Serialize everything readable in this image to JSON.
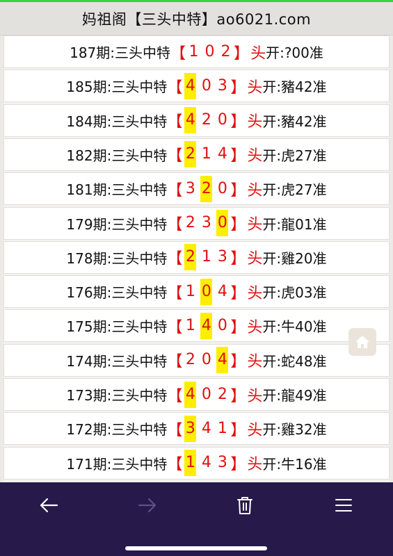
{
  "header": {
    "title": "妈祖阁【三头中特】ao6021.com"
  },
  "rows": [
    {
      "period": "187期:三头中特",
      "digits": [
        "1",
        "0",
        "2"
      ],
      "hit": -1,
      "result": "开:?00准"
    },
    {
      "period": "185期:三头中特",
      "digits": [
        "4",
        "0",
        "3"
      ],
      "hit": 0,
      "result": "开:豬42准"
    },
    {
      "period": "184期:三头中特",
      "digits": [
        "4",
        "2",
        "0"
      ],
      "hit": 0,
      "result": "开:豬42准"
    },
    {
      "period": "182期:三头中特",
      "digits": [
        "2",
        "1",
        "4"
      ],
      "hit": 0,
      "result": "开:虎27准"
    },
    {
      "period": "181期:三头中特",
      "digits": [
        "3",
        "2",
        "0"
      ],
      "hit": 1,
      "result": "开:虎27准"
    },
    {
      "period": "179期:三头中特",
      "digits": [
        "2",
        "3",
        "0"
      ],
      "hit": 2,
      "result": "开:龍01准"
    },
    {
      "period": "178期:三头中特",
      "digits": [
        "2",
        "1",
        "3"
      ],
      "hit": 0,
      "result": "开:雞20准"
    },
    {
      "period": "176期:三头中特",
      "digits": [
        "1",
        "0",
        "4"
      ],
      "hit": 1,
      "result": "开:虎03准"
    },
    {
      "period": "175期:三头中特",
      "digits": [
        "1",
        "4",
        "0"
      ],
      "hit": 1,
      "result": "开:牛40准"
    },
    {
      "period": "174期:三头中特",
      "digits": [
        "2",
        "0",
        "4"
      ],
      "hit": 2,
      "result": "开:蛇48准"
    },
    {
      "period": "173期:三头中特",
      "digits": [
        "4",
        "0",
        "2"
      ],
      "hit": 0,
      "result": "开:龍49准"
    },
    {
      "period": "172期:三头中特",
      "digits": [
        "3",
        "4",
        "1"
      ],
      "hit": 0,
      "result": "开:雞32准"
    },
    {
      "period": "171期:三头中特",
      "digits": [
        "1",
        "4",
        "3"
      ],
      "hit": 0,
      "result": "开:牛16准"
    }
  ],
  "labels": {
    "bracket_open": "【",
    "bracket_close": "】",
    "tou": "头"
  },
  "colors": {
    "accent_red": "#e01010",
    "highlight_yellow": "#ffee00",
    "nav_bg": "#27194a",
    "top_line": "#3ad13a"
  },
  "icons": {
    "home": "home-icon",
    "back": "arrow-left-icon",
    "forward": "arrow-right-icon",
    "delete": "trash-icon",
    "menu": "menu-icon"
  }
}
